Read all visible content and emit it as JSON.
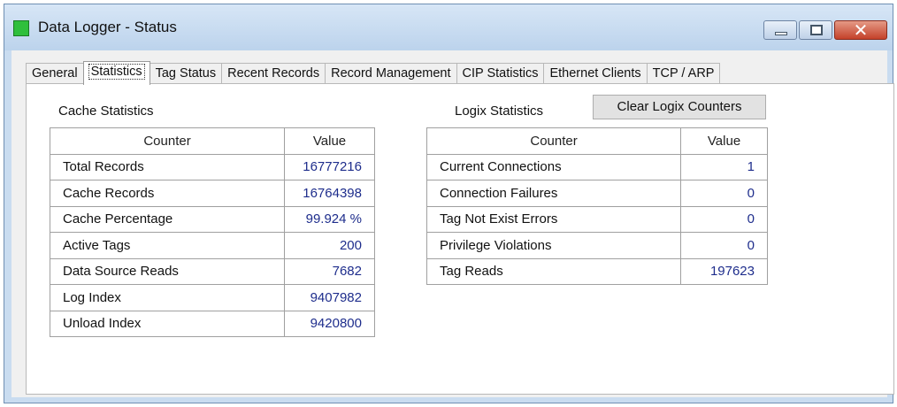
{
  "window": {
    "title": "Data Logger - Status",
    "close_glyph": "✕"
  },
  "tabs": [
    {
      "label": "General"
    },
    {
      "label": "Statistics",
      "active": true
    },
    {
      "label": "Tag Status"
    },
    {
      "label": "Recent Records"
    },
    {
      "label": "Record Management"
    },
    {
      "label": "CIP Statistics"
    },
    {
      "label": "Ethernet Clients"
    },
    {
      "label": "TCP / ARP"
    }
  ],
  "cache": {
    "label": "Cache Statistics",
    "headers": {
      "counter": "Counter",
      "value": "Value"
    },
    "rows": [
      {
        "name": "Total Records",
        "value": "16777216"
      },
      {
        "name": "Cache Records",
        "value": "16764398"
      },
      {
        "name": "Cache Percentage",
        "value": "99.924 %"
      },
      {
        "name": "Active Tags",
        "value": "200"
      },
      {
        "name": "Data Source Reads",
        "value": "7682"
      },
      {
        "name": "Log Index",
        "value": "9407982"
      },
      {
        "name": "Unload Index",
        "value": "9420800"
      }
    ]
  },
  "logix": {
    "label": "Logix Statistics",
    "clear_button": "Clear Logix Counters",
    "headers": {
      "counter": "Counter",
      "value": "Value"
    },
    "rows": [
      {
        "name": "Current Connections",
        "value": "1"
      },
      {
        "name": "Connection Failures",
        "value": "0"
      },
      {
        "name": "Tag Not Exist Errors",
        "value": "0"
      },
      {
        "name": "Privilege Violations",
        "value": "0"
      },
      {
        "name": "Tag Reads",
        "value": "197623"
      }
    ]
  },
  "colors": {
    "value_text": "#1e2d8c",
    "app_icon": "#2fbf3c",
    "close_button": "#c4412a"
  },
  "icons": {
    "app": "green-square-icon",
    "minimize": "minimize-icon",
    "maximize": "maximize-icon",
    "close": "close-icon"
  }
}
